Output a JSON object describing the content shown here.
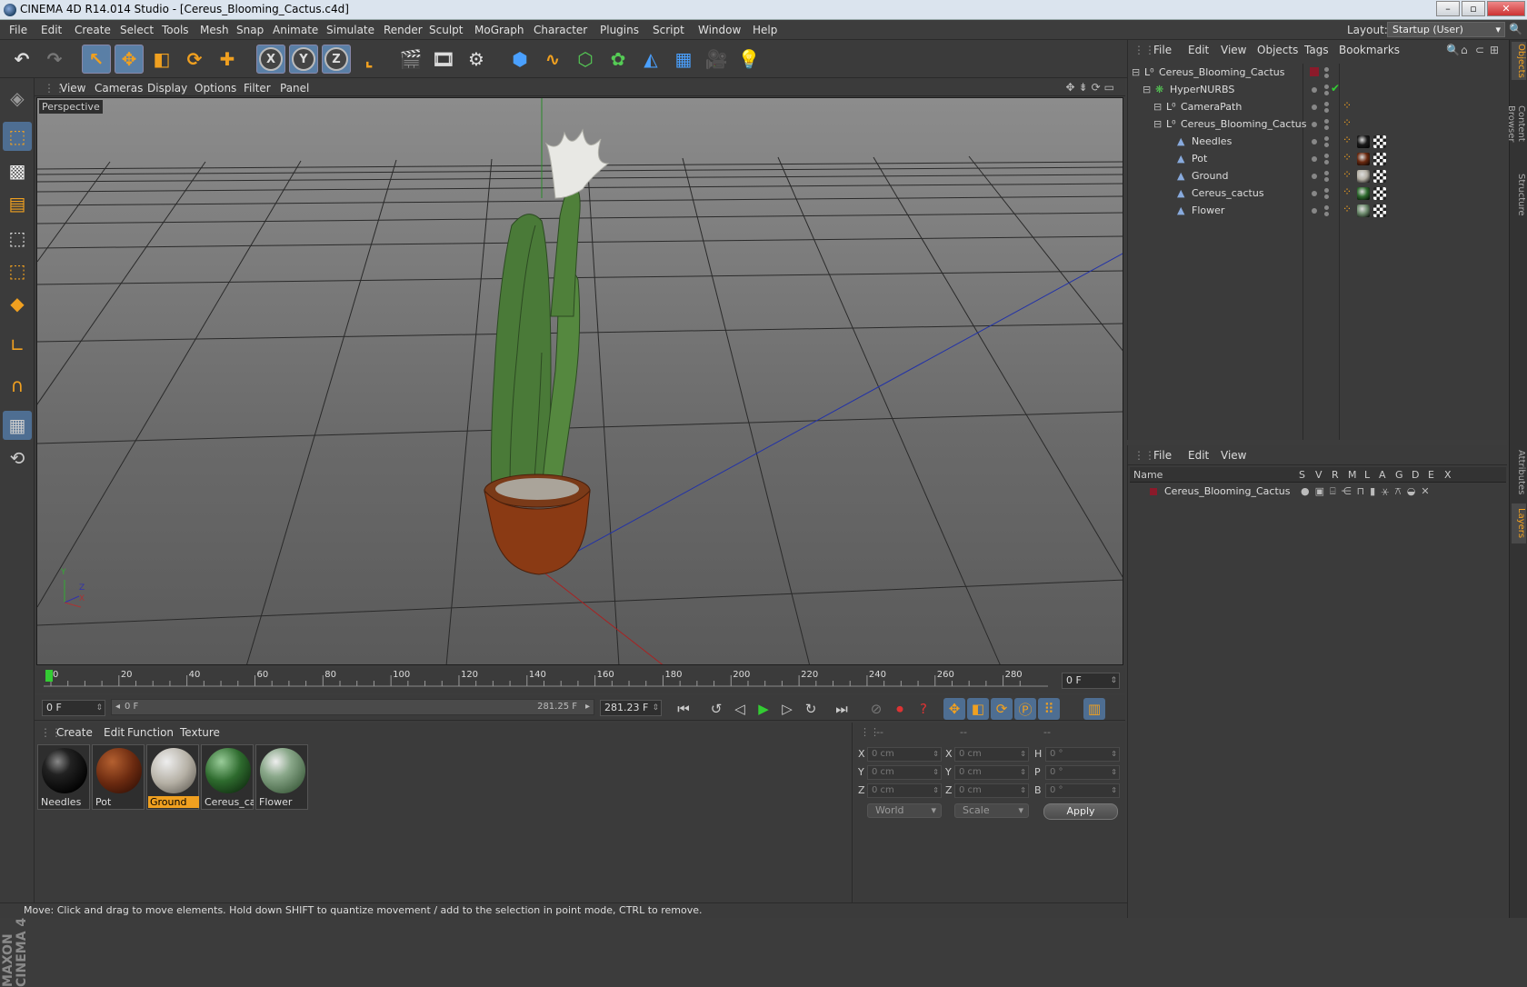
{
  "window": {
    "title": "CINEMA 4D R14.014 Studio - [Cereus_Blooming_Cactus.c4d]"
  },
  "menu": [
    "File",
    "Edit",
    "Create",
    "Select",
    "Tools",
    "Mesh",
    "Snap",
    "Animate",
    "Simulate",
    "Render",
    "Sculpt",
    "MoGraph",
    "Character",
    "Plugins",
    "Script",
    "Window",
    "Help"
  ],
  "layout": {
    "label": "Layout:",
    "value": "Startup (User)"
  },
  "viewport": {
    "menu": [
      "View",
      "Cameras",
      "Display",
      "Options",
      "Filter",
      "Panel"
    ],
    "label": "Perspective",
    "axes": {
      "y": "Y",
      "z": "Z",
      "x": "X"
    }
  },
  "timeline": {
    "ticks": [
      "0",
      "20",
      "40",
      "60",
      "80",
      "100",
      "120",
      "140",
      "160",
      "180",
      "200",
      "220",
      "240",
      "260",
      "280"
    ],
    "current_frame": "0 F",
    "start_field": "0 F",
    "range_start": "0 F",
    "range_end": "281.25 F",
    "end_field": "281.23 F"
  },
  "materials": {
    "menu": [
      "Create",
      "Edit",
      "Function",
      "Texture"
    ],
    "items": [
      {
        "name": "Needles",
        "color": "#1a1a1a"
      },
      {
        "name": "Pot",
        "color": "#6b2a10"
      },
      {
        "name": "Ground",
        "color": "#b5b0a5"
      },
      {
        "name": "Cereus_cac",
        "color": "#2e6b2e"
      },
      {
        "name": "Flower",
        "color": "#6c8a6c"
      }
    ],
    "selected": "Ground"
  },
  "coords": {
    "headers": [
      "--",
      "--",
      "--"
    ],
    "rows": [
      {
        "a": "X",
        "av": "0 cm",
        "b": "X",
        "bv": "0 cm",
        "c": "H",
        "cv": "0 °"
      },
      {
        "a": "Y",
        "av": "0 cm",
        "b": "Y",
        "bv": "0 cm",
        "c": "P",
        "cv": "0 °"
      },
      {
        "a": "Z",
        "av": "0 cm",
        "b": "Z",
        "bv": "0 cm",
        "c": "B",
        "cv": "0 °"
      }
    ],
    "mode": "World",
    "size": "Scale",
    "apply": "Apply"
  },
  "status": "Move: Click and drag to move elements. Hold down SHIFT to quantize movement / add to the selection in point mode, CTRL to remove.",
  "objects": {
    "menu": [
      "File",
      "Edit",
      "View",
      "Objects",
      "Tags",
      "Bookmarks"
    ],
    "rows": [
      {
        "name": "Cereus_Blooming_Cactus",
        "indent": 0,
        "icon": "null"
      },
      {
        "name": "HyperNURBS",
        "indent": 1,
        "icon": "nurbs"
      },
      {
        "name": "CameraPath",
        "indent": 2,
        "icon": "null"
      },
      {
        "name": "Cereus_Blooming_Cactus",
        "indent": 2,
        "icon": "null"
      },
      {
        "name": "Needles",
        "indent": 3,
        "icon": "poly"
      },
      {
        "name": "Pot",
        "indent": 3,
        "icon": "poly"
      },
      {
        "name": "Ground",
        "indent": 3,
        "icon": "poly"
      },
      {
        "name": "Cereus_cactus",
        "indent": 3,
        "icon": "poly"
      },
      {
        "name": "Flower",
        "indent": 3,
        "icon": "poly"
      }
    ]
  },
  "layers": {
    "menu": [
      "File",
      "Edit",
      "View"
    ],
    "columns": [
      "Name",
      "S",
      "V",
      "R",
      "M",
      "L",
      "A",
      "G",
      "D",
      "E",
      "X"
    ],
    "rows": [
      {
        "name": "Cereus_Blooming_Cactus",
        "color": "#8b1a2a"
      }
    ]
  },
  "sidetabs": [
    "Objects",
    "Content Browser",
    "Structure",
    "Attributes",
    "Layers"
  ],
  "brand": "MAXON CINEMA 4D",
  "colors": {
    "accent": "#f0a020",
    "selection": "#5a7fa6"
  }
}
